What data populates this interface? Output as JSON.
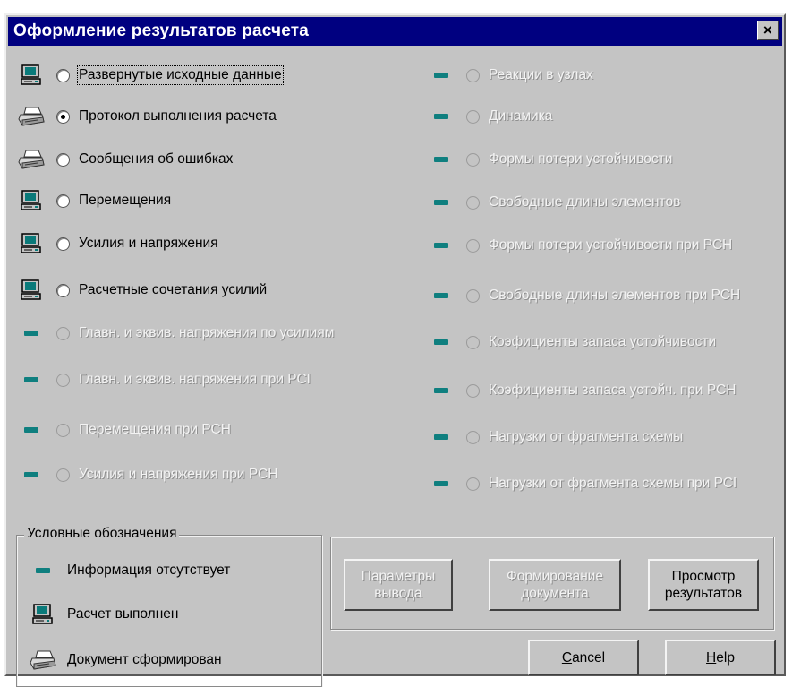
{
  "window": {
    "title": "Оформление результатов расчета",
    "close_label": "×"
  },
  "left_column": [
    {
      "icon": "computer-icon",
      "label": "Развернутые исходные данные",
      "enabled": true,
      "checked": false,
      "focused": true
    },
    {
      "icon": "printer-icon",
      "label": "Протокол выполнения расчета",
      "enabled": true,
      "checked": true
    },
    {
      "icon": "printer-icon",
      "label": "Сообщения об ошибках",
      "enabled": true,
      "checked": false
    },
    {
      "icon": "computer-icon",
      "label": "Перемещения",
      "enabled": true,
      "checked": false
    },
    {
      "icon": "computer-icon",
      "label": "Усилия и напряжения",
      "enabled": true,
      "checked": false
    },
    {
      "icon": "computer-icon",
      "label": "Расчетные сочетания усилий",
      "enabled": true,
      "checked": false
    },
    {
      "icon": "dash-icon",
      "label": "Главн. и эквив. напряжения по усилиям",
      "enabled": false,
      "checked": false
    },
    {
      "icon": "dash-icon",
      "label": "Главн. и эквив. напряжения при РСI",
      "enabled": false,
      "checked": false
    },
    {
      "icon": "dash-icon",
      "label": "Перемещения при РСН",
      "enabled": false,
      "checked": false
    },
    {
      "icon": "dash-icon",
      "label": "Усилия и напряжения при РСН",
      "enabled": false,
      "checked": false
    }
  ],
  "right_column": [
    {
      "icon": "dash-icon",
      "label": "Реакции в узлах",
      "enabled": false
    },
    {
      "icon": "dash-icon",
      "label": "Динамика",
      "enabled": false
    },
    {
      "icon": "dash-icon",
      "label": "Формы потери устойчивости",
      "enabled": false
    },
    {
      "icon": "dash-icon",
      "label": "Свободные длины элементов",
      "enabled": false
    },
    {
      "icon": "dash-icon",
      "label": "Формы потери устойчивости при РСН",
      "enabled": false
    },
    {
      "icon": "dash-icon",
      "label": "Свободные длины элементов при РСН",
      "enabled": false
    },
    {
      "icon": "dash-icon",
      "label": "Коэфициенты запаса устойчивости",
      "enabled": false
    },
    {
      "icon": "dash-icon",
      "label": "Коэфициенты запаса устойч. при РСН",
      "enabled": false
    },
    {
      "icon": "dash-icon",
      "label": "Нагрузки от фрагмента схемы",
      "enabled": false
    },
    {
      "icon": "dash-icon",
      "label": "Нагрузки от фрагмента схемы при РСI",
      "enabled": false
    }
  ],
  "legend": {
    "title": "Условные обозначения",
    "items": [
      {
        "icon": "dash-icon",
        "label": "Информация отсутствует"
      },
      {
        "icon": "computer-icon",
        "label": "Расчет выполнен"
      },
      {
        "icon": "printer-icon",
        "label": "Документ сформирован"
      }
    ]
  },
  "buttons": {
    "output_params": {
      "line1": "Параметры",
      "line2": "вывода",
      "enabled": false
    },
    "make_document": {
      "line1": "Формирование",
      "line2": "документа",
      "enabled": false
    },
    "view_results": {
      "line1": "Просмотр",
      "line2": "результатов",
      "enabled": true
    },
    "cancel": {
      "accel": "C",
      "rest": "ancel"
    },
    "help": {
      "accel": "H",
      "rest": "elp"
    }
  },
  "colors": {
    "title_bar": "#000080",
    "face": "#c4c4c4",
    "dash_teal": "#0f7f7f"
  }
}
